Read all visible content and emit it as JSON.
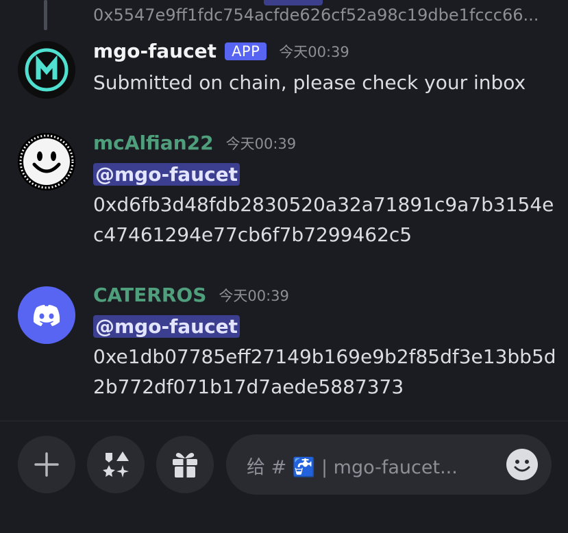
{
  "previous": {
    "hash": "0x5547e9ff1fdc754acfde626cf52a98c19dbe1fccc66..."
  },
  "messages": [
    {
      "author": "mgo-faucet",
      "badge": "APP",
      "time": "今天00:39",
      "lines": [
        "Submitted on chain, please check your inbox"
      ]
    },
    {
      "author": "mcAlfian22",
      "time": "今天00:39",
      "mention": "@mgo-faucet",
      "lines": [
        "0xd6fb3d48fdb2830520a32a71891c9a7b3154e",
        "c47461294e77cb6f7b7299462c5"
      ]
    },
    {
      "author": "CATERROS",
      "time": "今天00:39",
      "mention": "@mgo-faucet",
      "lines": [
        "0xe1db07785eff27149b169e9b2f85df3e13bb5d",
        "2b772df071b17d7aede5887373"
      ]
    }
  ],
  "composer": {
    "placeholder": "给 # 🚰 | mgo-faucet..."
  },
  "icons": {
    "add": "plus-icon",
    "apps": "apps-icon",
    "gift": "gift-icon",
    "emoji": "smiley-icon"
  },
  "colors": {
    "background": "#1b1c21",
    "accent": "#5865f2",
    "username_green": "#4f9f7d",
    "mention_bg": "#3c3f8f"
  }
}
